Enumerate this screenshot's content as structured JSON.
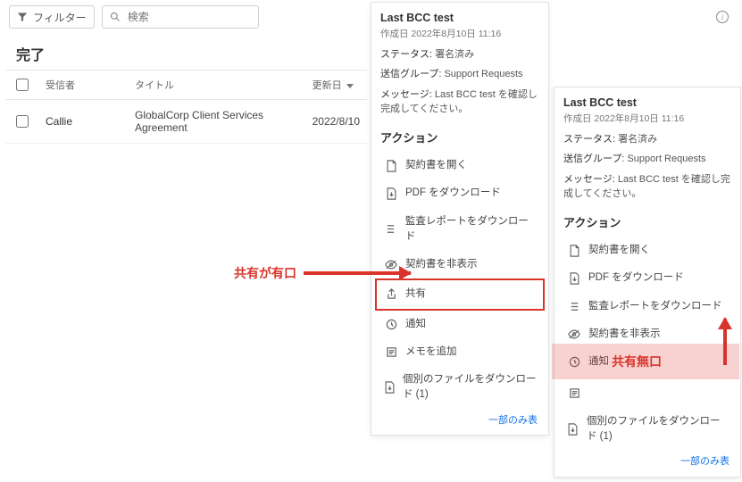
{
  "toolbar": {
    "filter_label": "フィルター",
    "search_placeholder": "検索"
  },
  "section": {
    "title": "完了"
  },
  "table": {
    "cols": {
      "recipient": "受信者",
      "title": "タイトル",
      "updated": "更新日"
    },
    "rows": [
      {
        "recipient": "Callie",
        "title": "GlobalCorp Client Services Agreement",
        "updated": "2022/8/10"
      }
    ]
  },
  "panel": {
    "title": "Last BCC test",
    "created_label": "作成日",
    "created_value": "2022年8月10日 11:16",
    "status_label": "ステータス:",
    "status_value": "署名済み",
    "group_label": "送信グループ:",
    "group_value": "Support Requests",
    "message_label": "メッセージ:",
    "message_value": "Last BCC test を確認し完成してください。",
    "actions_head": "アクション",
    "actions": {
      "open": "契約書を開く",
      "pdf": "PDF をダウンロード",
      "audit": "監査レポートをダウンロード",
      "hide": "契約書を非表示",
      "share": "共有",
      "remind": "通知",
      "note": "メモを追加",
      "files": "個別のファイルをダウンロード (1)"
    },
    "more": "一部のみ表"
  },
  "annot": {
    "enabled": "共有が有口",
    "disabled": "共有無口"
  }
}
